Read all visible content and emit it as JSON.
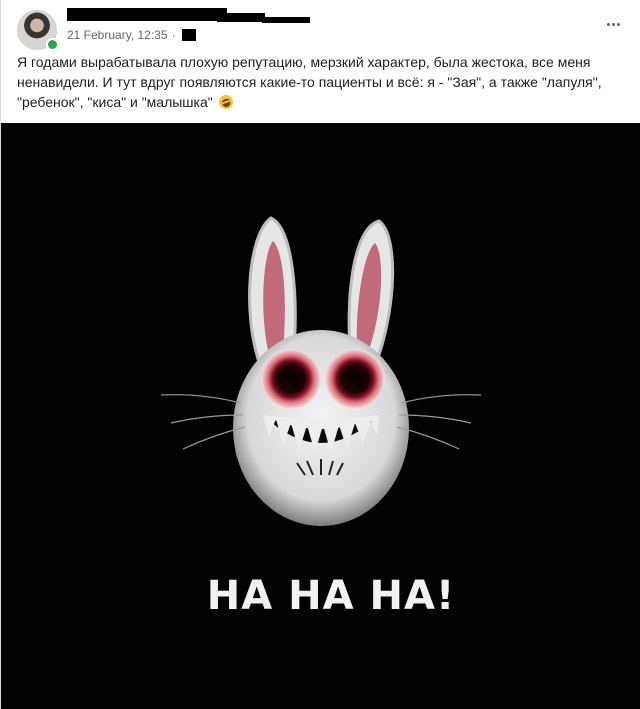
{
  "post": {
    "timestamp": "21 February, 12:35",
    "separator": "·",
    "text": "Я годами вырабатывала плохую репутацию, мерзкий характер, была жестока, все меня ненавидели. И тут вдруг появляются какие-то пациенты и всё: я - \"Зая\", а также \"лапуля\", \"ребенок\", \"киса\" и \"малышка\"",
    "emoji": "rolling-on-floor-laughing-emoji"
  },
  "image": {
    "caption": "HA HA HA!"
  },
  "colors": {
    "text": "#1c1e21",
    "secondary": "#65676b",
    "online": "#31a24c",
    "image_bg": "#020202"
  }
}
